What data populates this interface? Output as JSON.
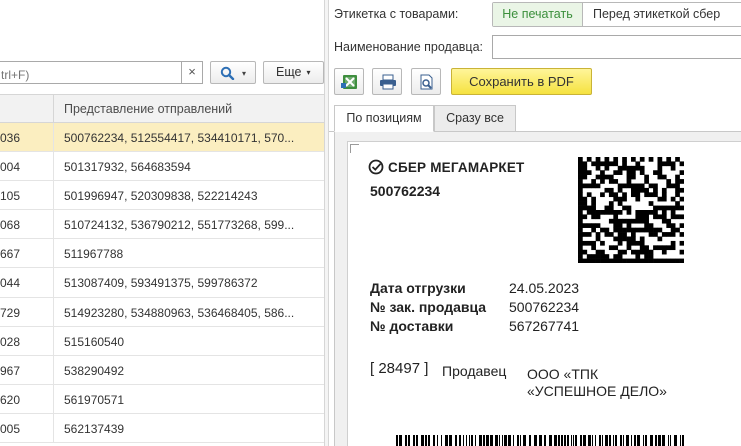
{
  "left": {
    "search_placeholder": "trl+F)",
    "clear_symbol": "×",
    "more_label": "Еще",
    "caret": "▾",
    "column_header": "Представление отправлений",
    "rows": [
      {
        "id": "036",
        "shipments": "500762234, 512554417, 534410171, 570...",
        "selected": true
      },
      {
        "id": "004",
        "shipments": "501317932, 564683594"
      },
      {
        "id": "105",
        "shipments": "501996947, 520309838, 522214243"
      },
      {
        "id": "068",
        "shipments": "510724132, 536790212, 551773268, 599..."
      },
      {
        "id": "667",
        "shipments": "511967788"
      },
      {
        "id": "044",
        "shipments": "513087409, 593491375, 599786372"
      },
      {
        "id": "729",
        "shipments": "514923280, 534880963, 536468405, 586..."
      },
      {
        "id": "028",
        "shipments": "515160540"
      },
      {
        "id": "967",
        "shipments": "538290492"
      },
      {
        "id": "620",
        "shipments": "561970571"
      },
      {
        "id": "005",
        "shipments": "562137439"
      }
    ]
  },
  "right": {
    "label_goods": "Этикетка с товарами:",
    "toggle_option_1": "Не печатать",
    "toggle_option_2": "Перед  этикеткой сбер",
    "label_seller_name": "Наименование продавца:",
    "seller_name_value": "",
    "save_pdf_label": "Сохранить в PDF",
    "tab_by_position": "По позициям",
    "tab_all_at_once": "Сразу все"
  },
  "document": {
    "brand": "СБЕР МЕГАМАРКЕТ",
    "order_number": "500762234",
    "fields": [
      {
        "label": "Дата отгрузки",
        "value": "24.05.2023"
      },
      {
        "label": "№ зак. продавца",
        "value": "500762234"
      },
      {
        "label": "№ доставки",
        "value": "567267741"
      }
    ],
    "seller_code": "28497",
    "seller_label": "Продавец",
    "seller_name_line1": "ООО «ТПК",
    "seller_name_line2": "«УСПЕШНОЕ ДЕЛО»"
  },
  "colors": {
    "selected_row": "#fbeec0",
    "toggle_active_text": "#3b8f3b",
    "pdf_button": "#f5e240",
    "brand_green": "#21a038"
  }
}
